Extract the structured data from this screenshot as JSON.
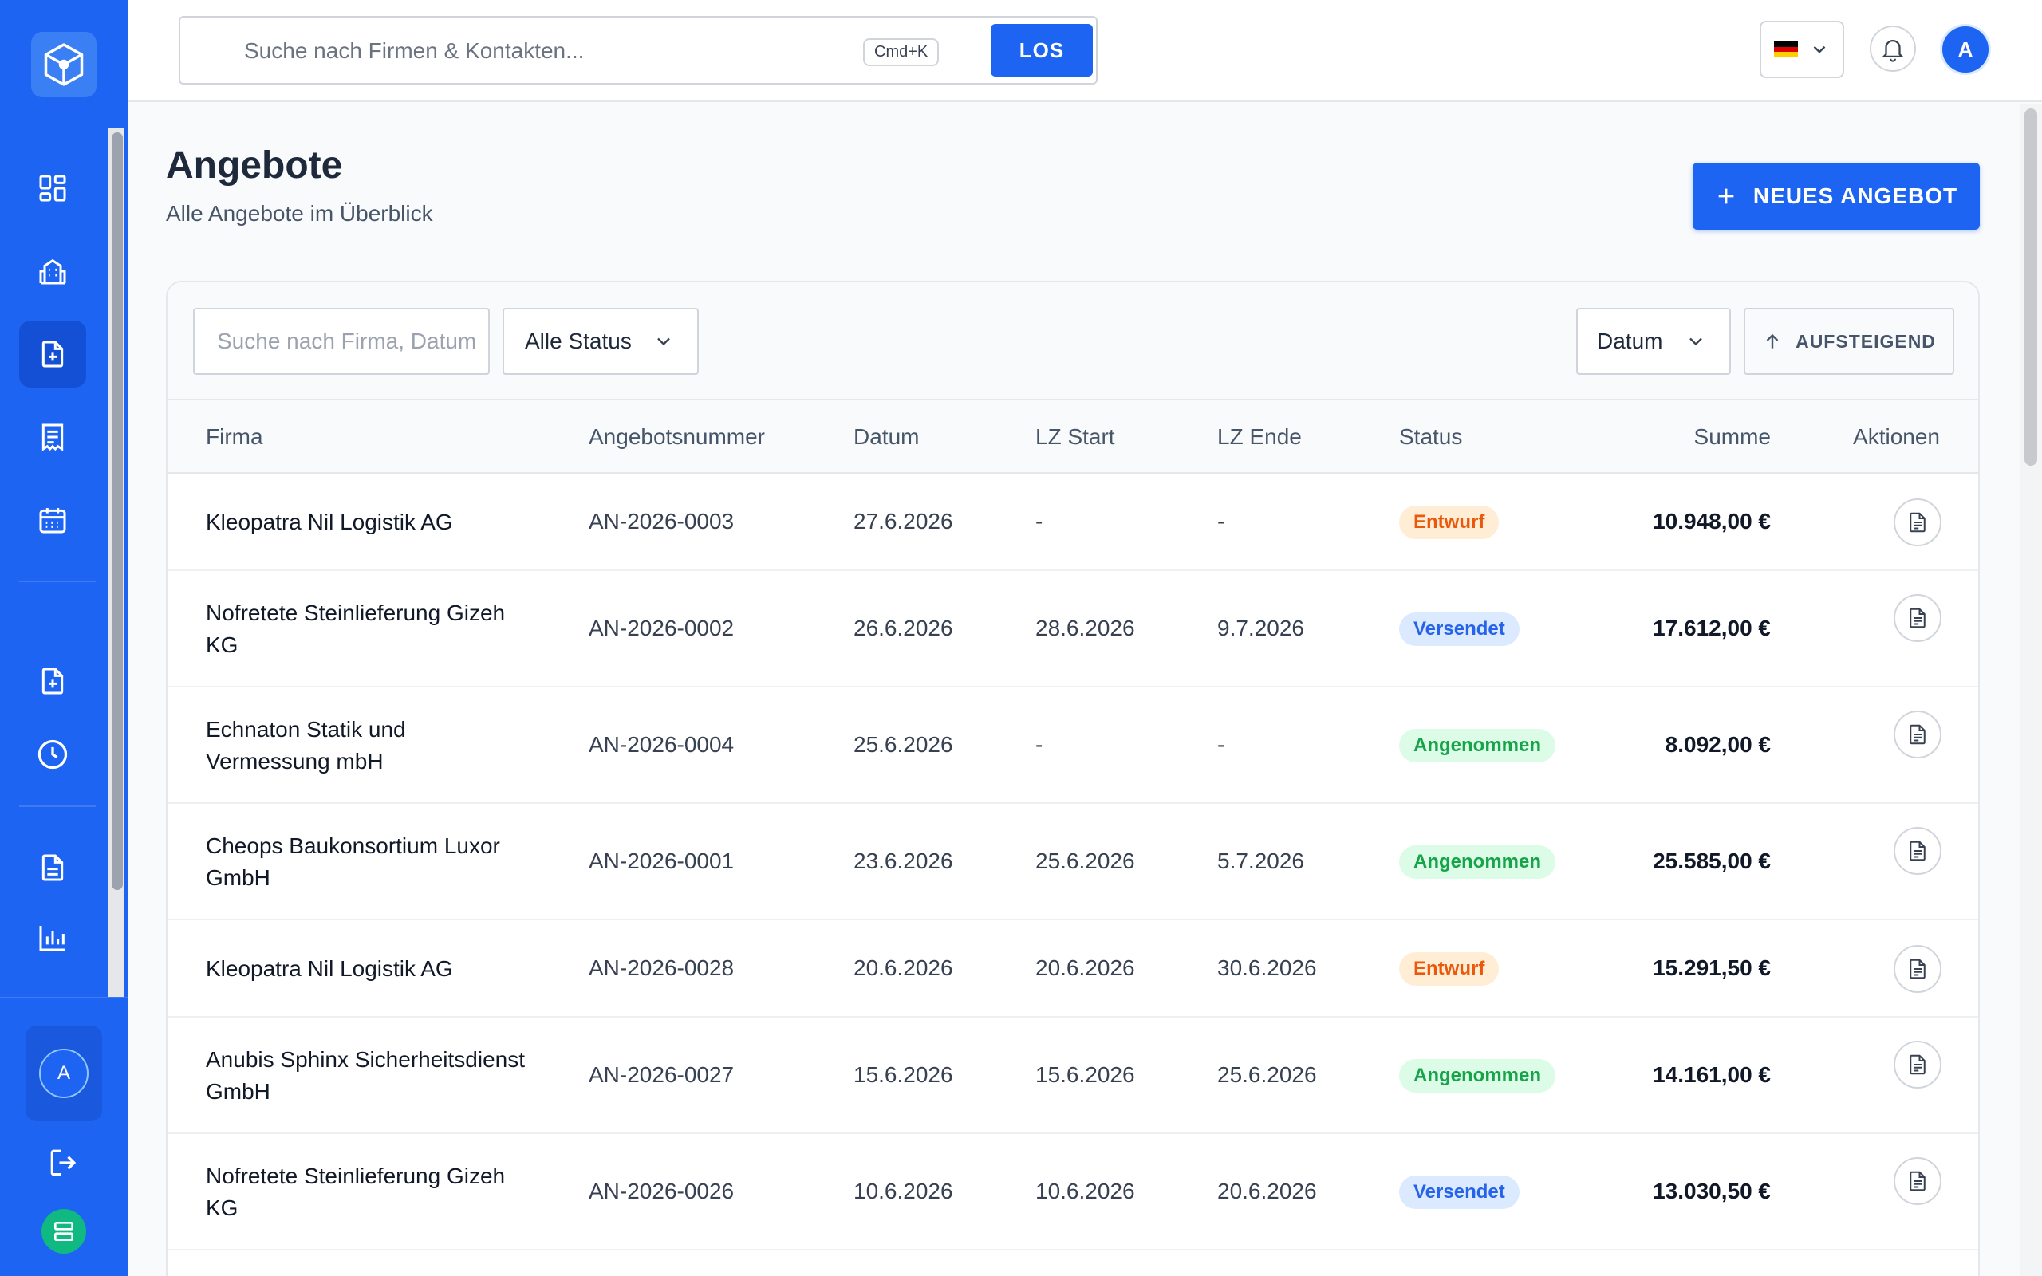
{
  "topbar": {
    "search_placeholder": "Suche nach Firmen & Kontakten...",
    "shortcut": "Cmd+K",
    "search_button": "LOS",
    "avatar_initial": "A"
  },
  "sidebar": {
    "user_initial": "A"
  },
  "page": {
    "title": "Angebote",
    "subtitle": "Alle Angebote im Überblick",
    "new_button": "NEUES ANGEBOT"
  },
  "filters": {
    "search_placeholder": "Suche nach Firma, Datum",
    "status_select": "Alle Status",
    "sort_select": "Datum",
    "sort_direction": "AUFSTEIGEND"
  },
  "table": {
    "headers": {
      "firma": "Firma",
      "nummer": "Angebotsnummer",
      "datum": "Datum",
      "lz_start": "LZ Start",
      "lz_ende": "LZ Ende",
      "status": "Status",
      "summe": "Summe",
      "aktionen": "Aktionen"
    },
    "rows": [
      {
        "firma": "Kleopatra Nil Logistik AG",
        "nummer": "AN-2026-0003",
        "datum": "27.6.2026",
        "lz_start": "-",
        "lz_ende": "-",
        "status": "Entwurf",
        "summe": "10.948,00 €"
      },
      {
        "firma": "Nofretete Steinlieferung Gizeh KG",
        "nummer": "AN-2026-0002",
        "datum": "26.6.2026",
        "lz_start": "28.6.2026",
        "lz_ende": "9.7.2026",
        "status": "Versendet",
        "summe": "17.612,00 €"
      },
      {
        "firma": "Echnaton Statik und Vermessung mbH",
        "nummer": "AN-2026-0004",
        "datum": "25.6.2026",
        "lz_start": "-",
        "lz_ende": "-",
        "status": "Angenommen",
        "summe": "8.092,00 €"
      },
      {
        "firma": "Cheops Baukonsortium Luxor GmbH",
        "nummer": "AN-2026-0001",
        "datum": "23.6.2026",
        "lz_start": "25.6.2026",
        "lz_ende": "5.7.2026",
        "status": "Angenommen",
        "summe": "25.585,00 €"
      },
      {
        "firma": "Kleopatra Nil Logistik AG",
        "nummer": "AN-2026-0028",
        "datum": "20.6.2026",
        "lz_start": "20.6.2026",
        "lz_ende": "30.6.2026",
        "status": "Entwurf",
        "summe": "15.291,50 €"
      },
      {
        "firma": "Anubis Sphinx Sicherheitsdienst GmbH",
        "nummer": "AN-2026-0027",
        "datum": "15.6.2026",
        "lz_start": "15.6.2026",
        "lz_ende": "25.6.2026",
        "status": "Angenommen",
        "summe": "14.161,00 €"
      },
      {
        "firma": "Nofretete Steinlieferung Gizeh KG",
        "nummer": "AN-2026-0026",
        "datum": "10.6.2026",
        "lz_start": "10.6.2026",
        "lz_ende": "20.6.2026",
        "status": "Versendet",
        "summe": "13.030,50 €"
      }
    ]
  }
}
